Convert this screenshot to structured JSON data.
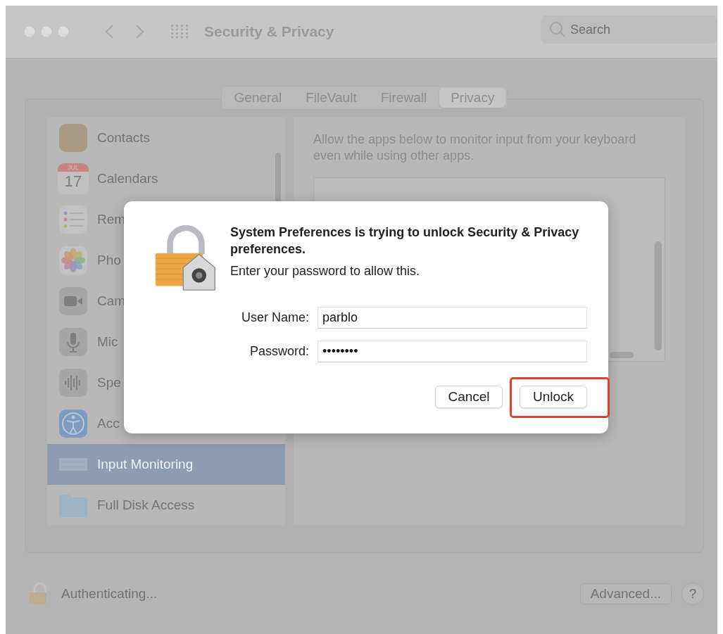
{
  "window": {
    "title": "Security & Privacy",
    "search": {
      "placeholder": "Search"
    }
  },
  "tabs": [
    {
      "label": "General",
      "selected": false
    },
    {
      "label": "FileVault",
      "selected": false
    },
    {
      "label": "Firewall",
      "selected": false
    },
    {
      "label": "Privacy",
      "selected": true
    }
  ],
  "sidebar": {
    "items": [
      {
        "kind": "contacts",
        "label": "Contacts",
        "selected": false
      },
      {
        "kind": "calendar",
        "label": "Calendars",
        "icon_month": "JUL",
        "icon_day": "17",
        "selected": false
      },
      {
        "kind": "reminders",
        "label": "Rem",
        "selected": false
      },
      {
        "kind": "photos",
        "label": "Pho",
        "selected": false
      },
      {
        "kind": "camera",
        "label": "Cam",
        "selected": false
      },
      {
        "kind": "microphone",
        "label": "Mic",
        "selected": false
      },
      {
        "kind": "speech",
        "label": "Spe",
        "selected": false
      },
      {
        "kind": "accessibility",
        "label": "Acc",
        "selected": false
      },
      {
        "kind": "keyboard",
        "label": "Input Monitoring",
        "selected": true
      },
      {
        "kind": "folder",
        "label": "Full Disk Access",
        "selected": false
      }
    ]
  },
  "detail": {
    "description": "Allow the apps below to monitor input from your keyboard even while using other apps."
  },
  "footer": {
    "status": "Authenticating...",
    "advanced_button": "Advanced...",
    "help_button": "?"
  },
  "dialog": {
    "title": "System Preferences is trying to unlock Security & Privacy preferences.",
    "message": "Enter your password to allow this.",
    "fields": [
      {
        "label": "User Name:",
        "value": "parblo"
      },
      {
        "label": "Password:",
        "value": "••••••••"
      }
    ],
    "buttons": [
      {
        "label": "Cancel",
        "highlighted": false
      },
      {
        "label": "Unlock",
        "highlighted": true
      }
    ]
  }
}
